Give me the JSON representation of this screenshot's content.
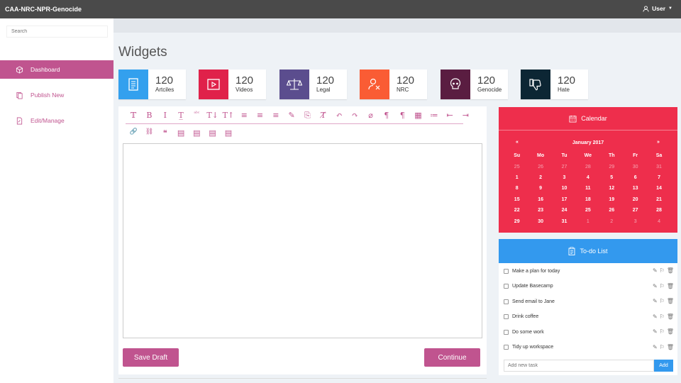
{
  "app": {
    "title": "CAA-NRC-NPR-Genocide",
    "user_label": "User"
  },
  "sidebar": {
    "search_placeholder": "Search",
    "items": [
      {
        "label": "Dashboard",
        "active": true
      },
      {
        "label": "Publish New",
        "active": false
      },
      {
        "label": "Edit/Manage",
        "active": false
      }
    ]
  },
  "page": {
    "title": "Widgets"
  },
  "cards": [
    {
      "value": "120",
      "label": "Artciles",
      "color": "#33a0ee",
      "icon": "document-icon"
    },
    {
      "value": "120",
      "label": "Videos",
      "color": "#e0214a",
      "icon": "video-icon"
    },
    {
      "value": "120",
      "label": "Legal",
      "color": "#5b4d8e",
      "icon": "scales-icon"
    },
    {
      "value": "120",
      "label": "NRC",
      "color": "#fa5c34",
      "icon": "user-remove-icon"
    },
    {
      "value": "120",
      "label": "Genocide",
      "color": "#5a1d41",
      "icon": "skull-icon"
    },
    {
      "value": "120",
      "label": "Hate",
      "color": "#0c2634",
      "icon": "thumbs-down-icon"
    }
  ],
  "editor": {
    "toolbar_row1": [
      "𝕋",
      "B",
      "I",
      "T̲",
      "ᵃᵇᶜ",
      "T↓",
      "T↑",
      "≡",
      "≡",
      "≡",
      "✎",
      "⎘",
      "T̸",
      "↶",
      "↷",
      "⌀",
      "¶",
      "¶",
      "▦",
      "≔",
      "⇤",
      "⇥"
    ],
    "toolbar_row2": [
      "🔗",
      "⛓",
      "❝",
      "▤",
      "▤",
      "▤",
      "▤"
    ],
    "save_label": "Save Draft",
    "continue_label": "Continue"
  },
  "calendar": {
    "title": "Calendar",
    "month": "January 2017",
    "prev": "«",
    "next": "»",
    "days": [
      "Su",
      "Mo",
      "Tu",
      "We",
      "Th",
      "Fr",
      "Sa"
    ],
    "weeks": [
      [
        "25",
        "26",
        "27",
        "28",
        "29",
        "30",
        "31"
      ],
      [
        "1",
        "2",
        "3",
        "4",
        "5",
        "6",
        "7"
      ],
      [
        "8",
        "9",
        "10",
        "11",
        "12",
        "13",
        "14"
      ],
      [
        "15",
        "16",
        "17",
        "18",
        "19",
        "20",
        "21"
      ],
      [
        "22",
        "23",
        "24",
        "25",
        "26",
        "27",
        "28"
      ],
      [
        "29",
        "30",
        "31",
        "1",
        "2",
        "3",
        "4"
      ]
    ],
    "accent": "#ee2e4c"
  },
  "todo": {
    "title": "To-do List",
    "items": [
      "Make a plan for today",
      "Update Basecamp",
      "Send email to Jane",
      "Drink coffee",
      "Do some work",
      "Tidy up workspace"
    ],
    "add_placeholder": "Add new task",
    "add_label": "Add",
    "accent": "#3399ee"
  }
}
